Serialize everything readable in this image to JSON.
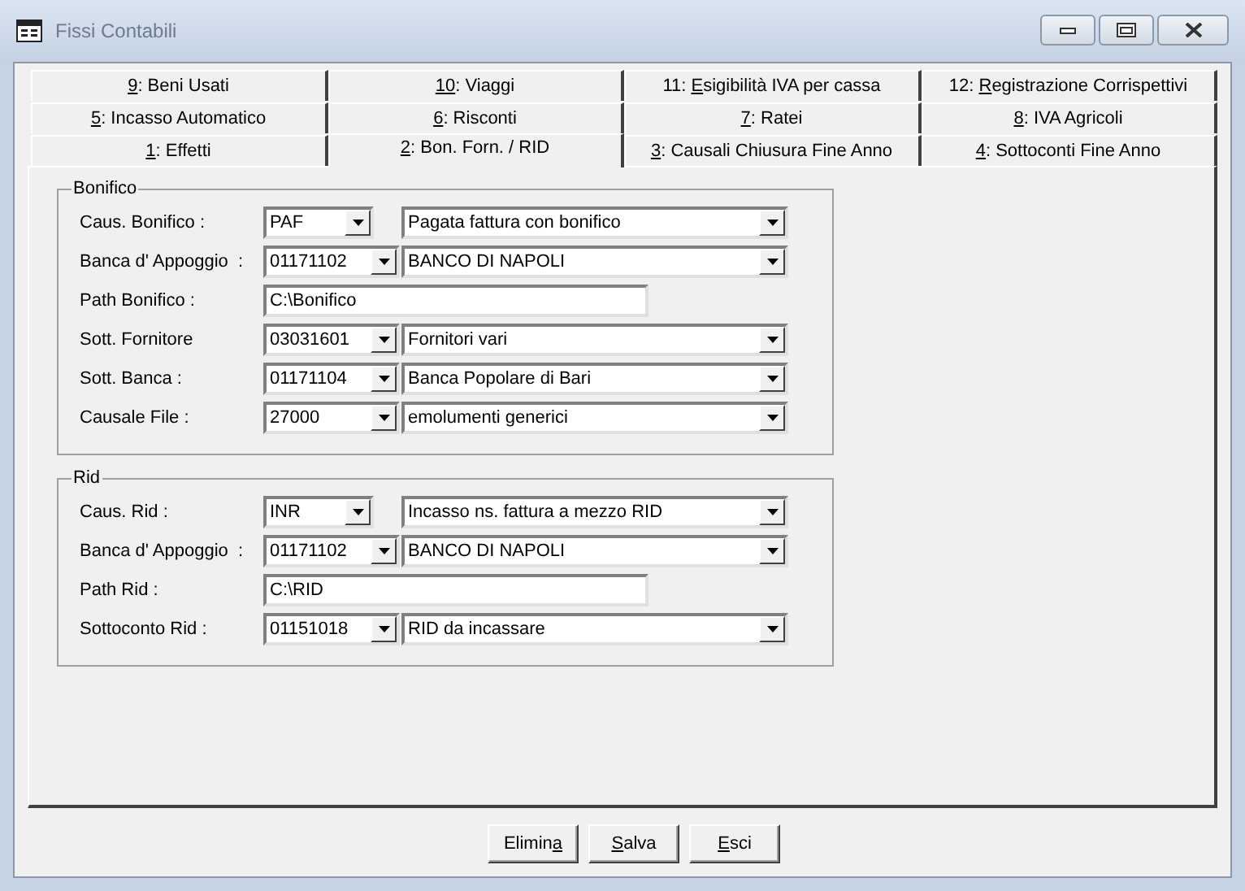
{
  "window": {
    "title": "Fissi Contabili"
  },
  "tab_rows": [
    [
      {
        "mnemonic": "9",
        "after": ": Beni Usati",
        "selected": false
      },
      {
        "mnemonic": "10",
        "after": ": Viaggi",
        "selected": false
      },
      {
        "before": "11: ",
        "mnemonic": "E",
        "after": "sigibilità IVA per cassa",
        "selected": false
      },
      {
        "before": "12: ",
        "mnemonic": "R",
        "after": "egistrazione Corrispettivi",
        "selected": false
      }
    ],
    [
      {
        "mnemonic": "5",
        "after": ": Incasso Automatico",
        "selected": false
      },
      {
        "mnemonic": "6",
        "after": ": Risconti",
        "selected": false
      },
      {
        "mnemonic": "7",
        "after": ": Ratei",
        "selected": false
      },
      {
        "mnemonic": "8",
        "after": ": IVA Agricoli",
        "selected": false
      }
    ],
    [
      {
        "mnemonic": "1",
        "after": ": Effetti",
        "selected": false
      },
      {
        "mnemonic": "2",
        "after": ": Bon. Forn. / RID",
        "selected": true
      },
      {
        "mnemonic": "3",
        "after": ": Causali Chiusura Fine Anno",
        "selected": false
      },
      {
        "mnemonic": "4",
        "after": ": Sottoconti Fine Anno",
        "selected": false
      }
    ]
  ],
  "groups": [
    {
      "title": "Bonifico",
      "rows": [
        {
          "kind": "combo",
          "label": "Caus. Bonifico :",
          "code": "PAF",
          "short": true,
          "description": "Pagata fattura con bonifico"
        },
        {
          "kind": "combo",
          "label": "Banca d' Appoggio  :",
          "code": "01171102",
          "short": false,
          "description": "BANCO DI NAPOLI"
        },
        {
          "kind": "path",
          "label": "Path Bonifico :",
          "value": "C:\\Bonifico"
        },
        {
          "kind": "combo",
          "label": "Sott. Fornitore",
          "code": "03031601",
          "short": false,
          "description": "Fornitori vari"
        },
        {
          "kind": "combo",
          "label": "Sott. Banca :",
          "code": "01171104",
          "short": false,
          "description": "Banca Popolare di Bari"
        },
        {
          "kind": "combo",
          "label": "Causale File :",
          "code": "27000",
          "short": false,
          "description": "emolumenti generici"
        }
      ]
    },
    {
      "title": "Rid",
      "rows": [
        {
          "kind": "combo",
          "label": "Caus. Rid :",
          "code": "INR",
          "short": true,
          "description": "Incasso ns. fattura a mezzo RID"
        },
        {
          "kind": "combo",
          "label": "Banca d' Appoggio  :",
          "code": "01171102",
          "short": false,
          "description": "BANCO DI NAPOLI"
        },
        {
          "kind": "path",
          "label": "Path Rid :",
          "value": "C:\\RID"
        },
        {
          "kind": "combo",
          "label": "Sottoconto Rid :",
          "code": "01151018",
          "short": false,
          "description": "RID da incassare"
        }
      ]
    }
  ],
  "buttons": [
    {
      "before": "Elimin",
      "mnemonic": "a"
    },
    {
      "mnemonic": "S",
      "after": "alva"
    },
    {
      "mnemonic": "E",
      "after": "sci"
    }
  ]
}
